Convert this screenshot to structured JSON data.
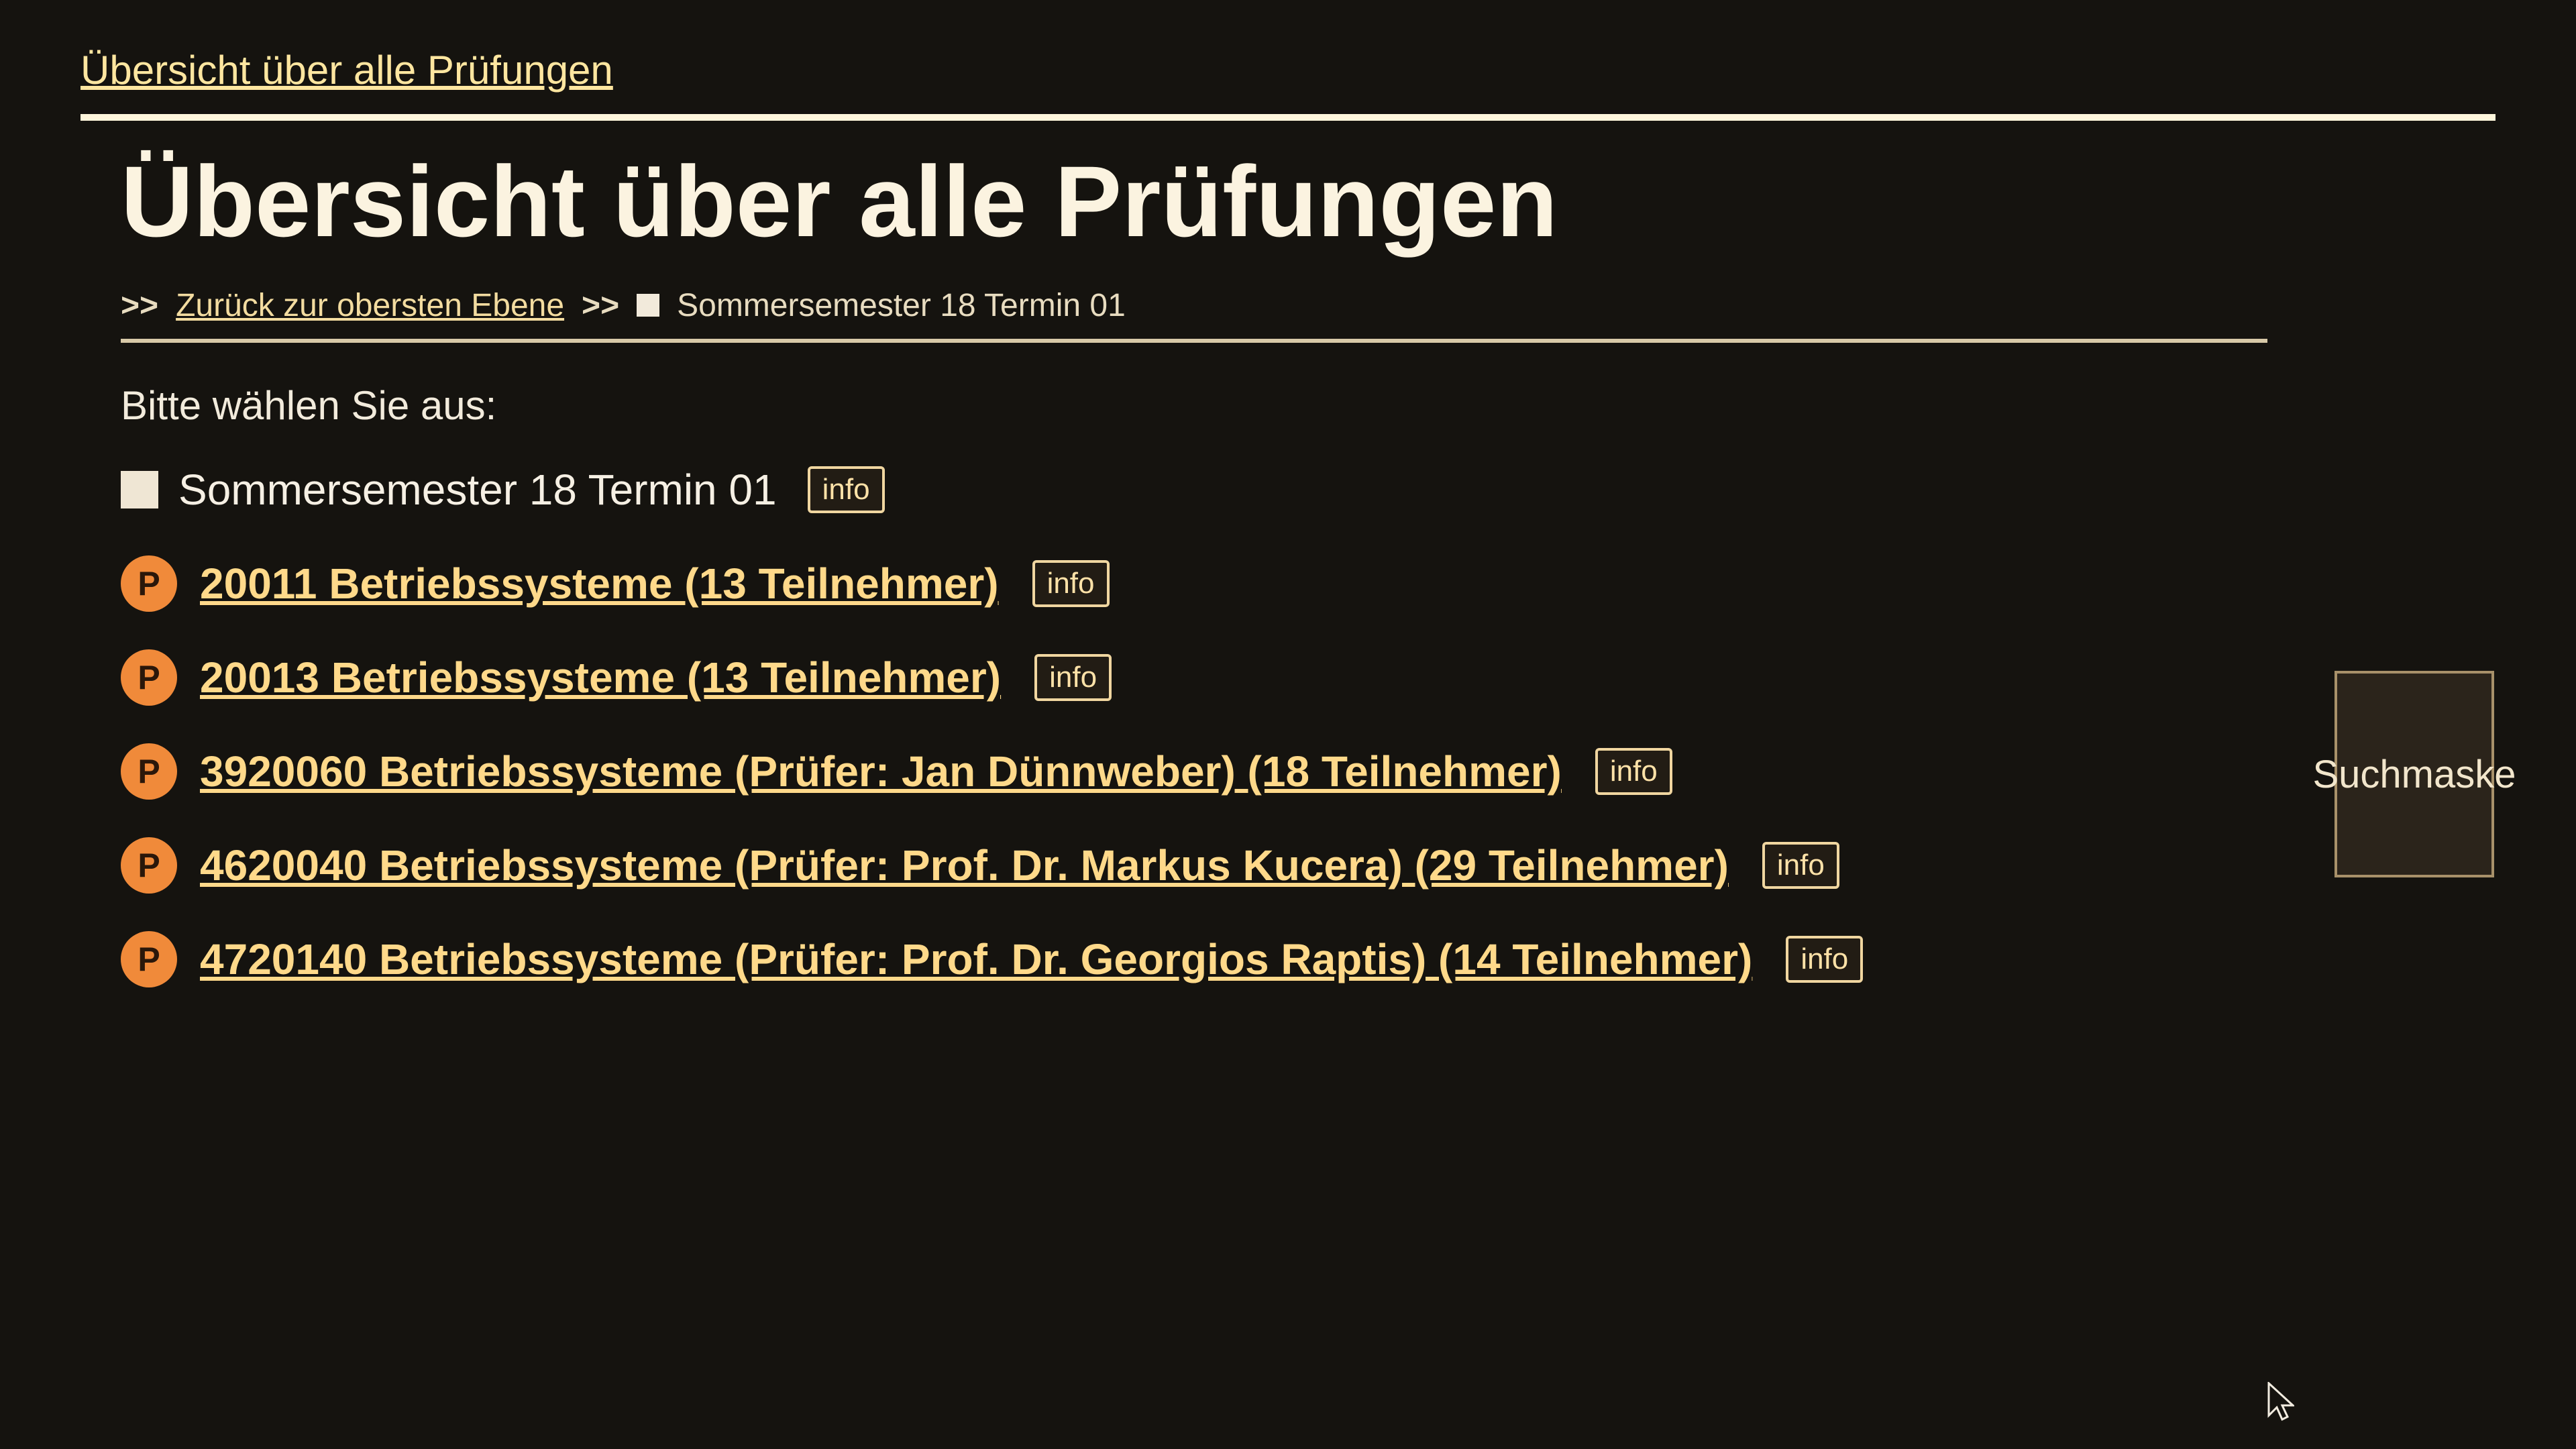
{
  "header": {
    "top_link": "Übersicht über alle Prüfungen",
    "title": "Übersicht über alle Prüfungen"
  },
  "breadcrumb": {
    "sep1": ">>",
    "back_label": "Zurück zur obersten Ebene",
    "sep2": ">>",
    "current": "Sommersemester 18 Termin 01"
  },
  "main": {
    "prompt": "Bitte wählen Sie aus:",
    "semester_label": "Sommersemester 18 Termin 01",
    "badge_label": "P",
    "info_label": "info",
    "search_label": "Suchmaske",
    "exams": [
      {
        "label": "20011 Betriebssysteme (13 Teilnehmer)"
      },
      {
        "label": "20013 Betriebssysteme (13 Teilnehmer)"
      },
      {
        "label": "3920060 Betriebssysteme (Prüfer: Jan Dünnweber) (18 Teilnehmer)"
      },
      {
        "label": "4620040 Betriebssysteme (Prüfer: Prof. Dr. Markus Kucera) (29 Teilnehmer)"
      },
      {
        "label": "4720140 Betriebssysteme (Prüfer: Prof. Dr. Georgios Raptis) (14 Teilnehmer)"
      }
    ]
  },
  "colors": {
    "background": "#15130f",
    "accent_orange": "#f08a3a",
    "link": "#ffd98a"
  }
}
